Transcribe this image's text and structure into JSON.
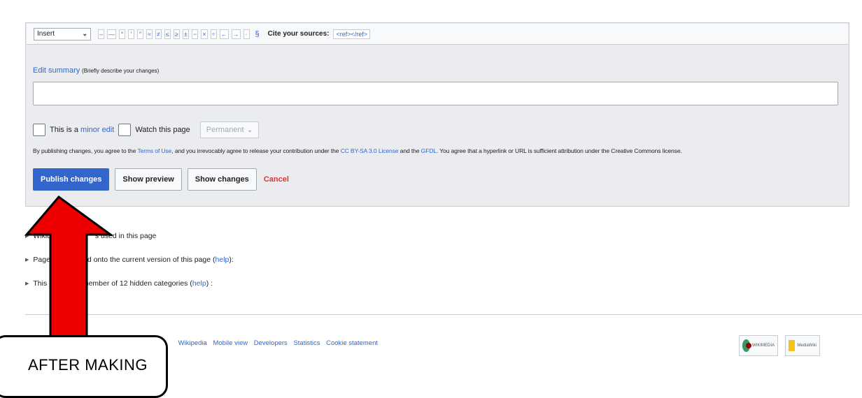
{
  "toolbar": {
    "insert_select": "Insert",
    "special_chars": [
      "–",
      "—",
      "°",
      "′",
      "″",
      "≈",
      "≠",
      "≤",
      "≥",
      "±",
      "−",
      "×",
      "÷",
      "←",
      "→",
      "·"
    ],
    "section_sign": "§",
    "cite_label": "Cite your sources:",
    "cite_link": "<ref></ref>"
  },
  "summary": {
    "label": "Edit summary",
    "hint": "(Briefly describe your changes)",
    "value": ""
  },
  "options": {
    "minor_prefix": "This is a",
    "minor_link": "minor edit",
    "watch_label": "Watch this page",
    "watch_select": "Permanent"
  },
  "license": {
    "part1": "By publishing changes, you agree to the",
    "terms_link": "Terms of Use",
    "part2": ", and you irrevocably agree to release your contribution under the",
    "cc_link": "CC BY-SA 3.0 License",
    "part3": "and the",
    "gfdl_link": "GFDL",
    "part4": ". You agree that a hyperlink or URL is sufficient attribution under the Creative Commons license."
  },
  "buttons": {
    "publish": "Publish changes",
    "preview": "Show preview",
    "changes": "Show changes",
    "cancel": "Cancel"
  },
  "meta": {
    "wikidata": "Wikidat",
    "wikidata_rest": "s used in this page",
    "templates": "Pages t",
    "templates_rest": "ed onto the current version of this page (",
    "templates_help": "help",
    "templates_end": "):",
    "categories": "This pa",
    "categories_rest": "member of 12 hidden categories (",
    "categories_help": "help",
    "categories_end": ") :"
  },
  "footer": {
    "links": [
      "Wikipedia",
      "Mobile view",
      "Developers",
      "Statistics",
      "Cookie statement"
    ],
    "wikimedia_badge": "WIKIMEDIA",
    "mediawiki_badge": "MediaWiki"
  },
  "annotation": {
    "text": "AFTER MAKING",
    "arrow_color": "#ee0000"
  }
}
